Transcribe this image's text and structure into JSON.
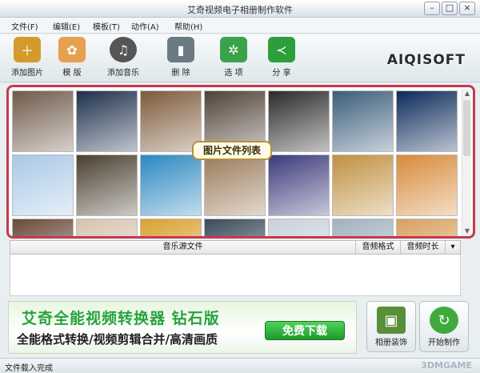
{
  "window": {
    "title": "艾奇视频电子相册制作软件"
  },
  "menu": [
    "文件(F)",
    "编辑(E)",
    "模板(T)",
    "动作(A)",
    "帮助(H)"
  ],
  "toolbar": {
    "buttons": [
      {
        "label": "添加图片",
        "icon": "add-image-icon",
        "color": "#d29b2c"
      },
      {
        "label": "模 版",
        "icon": "template-icon",
        "color": "#e5a14e"
      },
      {
        "label": "添加音乐",
        "icon": "add-music-icon",
        "color": "#555555"
      },
      {
        "label": "删 除",
        "icon": "trash-icon",
        "color": "#6b7b84"
      },
      {
        "label": "选 项",
        "icon": "gear-icon",
        "color": "#3aa34a"
      },
      {
        "label": "分 享",
        "icon": "share-icon",
        "color": "#2c9f3c"
      }
    ],
    "brand": "AIQISOFT"
  },
  "gallery": {
    "callout": "图片文件列表",
    "thumb_colors": [
      "#6f5a4a",
      "#1d2f4b",
      "#7d5a3a",
      "#4f4136",
      "#2b2a29",
      "#3a5d7a",
      "#0c2a5a",
      "#a8c8e6",
      "#4a4030",
      "#2a88c0",
      "#9a7a5a",
      "#3c3a7a",
      "#c09040",
      "#d88a3a",
      "#6a4a3a",
      "#d6c4b0",
      "#d8a030",
      "#3a4a5a",
      "#c8d2da",
      "#a0b0c0",
      "#d8a060"
    ]
  },
  "music_table": {
    "col_file": "音乐源文件",
    "col_format": "音频格式",
    "col_duration": "音频时长"
  },
  "ad": {
    "title": "艾奇全能视频转换器 钻石版",
    "subtitle": "全能格式转换/视频剪辑合并/高清画质",
    "button": "免费下载"
  },
  "actions": {
    "decorate_label": "相册装饰",
    "start_label": "开始制作"
  },
  "status": {
    "text": "文件载入完成"
  },
  "watermark": "3DMGAME",
  "colors": {
    "highlight_border": "#c43a4f",
    "ad_green": "#27a33d"
  }
}
